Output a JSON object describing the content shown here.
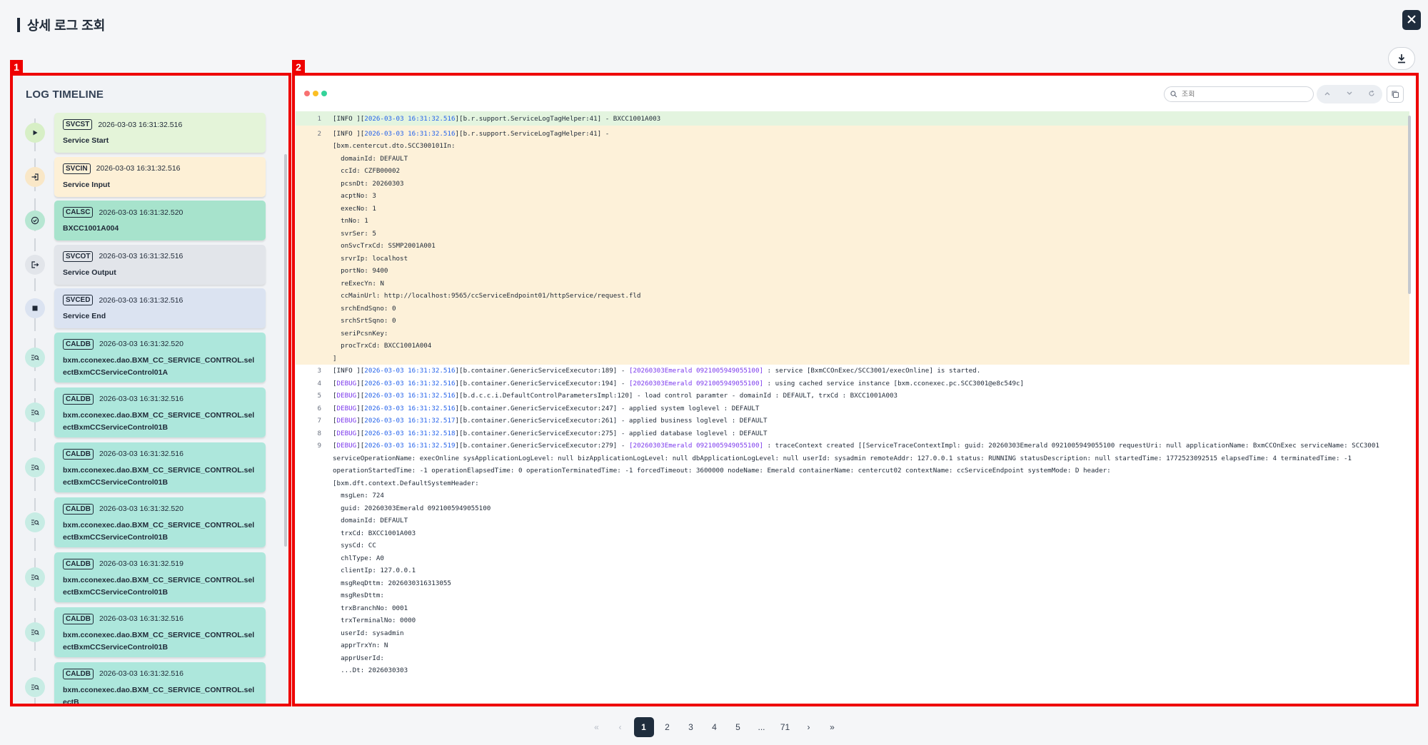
{
  "header": {
    "title": "상세 로그 조회"
  },
  "frames": {
    "left_tag": "1",
    "right_tag": "2"
  },
  "timeline": {
    "title": "LOG TIMELINE",
    "items": [
      {
        "code": "SVCST",
        "time": "2026-03-03 16:31:32.516",
        "name": "Service Start",
        "icon": "play-icon",
        "color": "#e4f4d9",
        "dot": "#d7efc6"
      },
      {
        "code": "SVCIN",
        "time": "2026-03-03 16:31:32.516",
        "name": "Service Input",
        "icon": "login-icon",
        "color": "#fdf0d6",
        "dot": "#f9e7c7"
      },
      {
        "code": "CALSC",
        "time": "2026-03-03 16:31:32.520",
        "name": "BXCC1001A004",
        "icon": "check-circle-icon",
        "color": "#a7e3cc",
        "dot": "#b6e6d2"
      },
      {
        "code": "SVCOT",
        "time": "2026-03-03 16:31:32.516",
        "name": "Service Output",
        "icon": "logout-icon",
        "color": "#e2e5ea",
        "dot": "#e2e5ea"
      },
      {
        "code": "SVCED",
        "time": "2026-03-03 16:31:32.516",
        "name": "Service End",
        "icon": "stop-icon",
        "color": "#dbe3f1",
        "dot": "#dbe3f1"
      },
      {
        "code": "CALDB",
        "time": "2026-03-03 16:31:32.520",
        "name": "bxm.cconexec.dao.BXM_CC_SERVICE_CONTROL.selectBxmCCServiceControl01A",
        "icon": "db-search-icon",
        "color": "#ade7dc",
        "dot": "#c7ece4"
      },
      {
        "code": "CALDB",
        "time": "2026-03-03 16:31:32.516",
        "name": "bxm.cconexec.dao.BXM_CC_SERVICE_CONTROL.selectBxmCCServiceControl01B",
        "icon": "db-search-icon",
        "color": "#ade7dc",
        "dot": "#c7ece4"
      },
      {
        "code": "CALDB",
        "time": "2026-03-03 16:31:32.516",
        "name": "bxm.cconexec.dao.BXM_CC_SERVICE_CONTROL.selectBxmCCServiceControl01B",
        "icon": "db-search-icon",
        "color": "#ade7dc",
        "dot": "#c7ece4"
      },
      {
        "code": "CALDB",
        "time": "2026-03-03 16:31:32.520",
        "name": "bxm.cconexec.dao.BXM_CC_SERVICE_CONTROL.selectBxmCCServiceControl01B",
        "icon": "db-search-icon",
        "color": "#ade7dc",
        "dot": "#c7ece4"
      },
      {
        "code": "CALDB",
        "time": "2026-03-03 16:31:32.519",
        "name": "bxm.cconexec.dao.BXM_CC_SERVICE_CONTROL.selectBxmCCServiceControl01B",
        "icon": "db-search-icon",
        "color": "#ade7dc",
        "dot": "#c7ece4"
      },
      {
        "code": "CALDB",
        "time": "2026-03-03 16:31:32.516",
        "name": "bxm.cconexec.dao.BXM_CC_SERVICE_CONTROL.selectBxmCCServiceControl01B",
        "icon": "db-search-icon",
        "color": "#ade7dc",
        "dot": "#c7ece4"
      },
      {
        "code": "CALDB",
        "time": "2026-03-03 16:31:32.516",
        "name": "bxm.cconexec.dao.BXM_CC_SERVICE_CONTROL.selectB",
        "icon": "db-search-icon",
        "color": "#ade7dc",
        "dot": "#c7ece4"
      }
    ]
  },
  "log_view": {
    "search_placeholder": "조회",
    "lines": [
      {
        "n": "1",
        "hl": "green",
        "level": "INFO ",
        "ts": "2026-03-03 16:31:32.516",
        "text": "[b.r.support.ServiceLogTagHelper:41] - BXCC1001A003"
      },
      {
        "n": "2",
        "hl": "yellow",
        "level": "INFO ",
        "ts": "2026-03-03 16:31:32.516",
        "text": "[b.r.support.ServiceLogTagHelper:41] -\n[bxm.centercut.dto.SCC300101In:\n  domainId: DEFAULT\n  ccId: CZFB00002\n  pcsnDt: 20260303\n  acptNo: 3\n  execNo: 1\n  tnNo: 1\n  svrSer: 5\n  onSvcTrxCd: SSMP2001A001\n  srvrIp: localhost\n  portNo: 9400\n  reExecYn: N\n  ccMainUrl: http://localhost:9565/ccServiceEndpoint01/httpService/request.fld\n  srchEndSqno: 0\n  srchSrtSqno: 0\n  seriPcsnKey:\n  procTrxCd: BXCC1001A004\n]\n"
      },
      {
        "n": "3",
        "hl": "",
        "level": "INFO ",
        "ts": "2026-03-03 16:31:32.516",
        "text": "[b.container.GenericServiceExecutor:189] - ",
        "guid": "[20260303Emerald 0921005949055100]",
        "tail": " : service [BxmCCOnExec/SCC3001/execOnline] is started."
      },
      {
        "n": "4",
        "hl": "",
        "level": "DEBUG",
        "ts": "2026-03-03 16:31:32.516",
        "text": "[b.container.GenericServiceExecutor:194] - ",
        "guid": "[20260303Emerald 0921005949055100]",
        "tail": " : using cached service instance [bxm.cconexec.pc.SCC3001@e8c549c]"
      },
      {
        "n": "5",
        "hl": "",
        "level": "DEBUG",
        "ts": "2026-03-03 16:31:32.516",
        "text": "[b.d.c.c.i.DefaultControlParametersImpl:120] - load control paramter - domainId : DEFAULT, trxCd : BXCC1001A003"
      },
      {
        "n": "6",
        "hl": "",
        "level": "DEBUG",
        "ts": "2026-03-03 16:31:32.516",
        "text": "[b.container.GenericServiceExecutor:247] - applied system loglevel : DEFAULT"
      },
      {
        "n": "7",
        "hl": "",
        "level": "DEBUG",
        "ts": "2026-03-03 16:31:32.517",
        "text": "[b.container.GenericServiceExecutor:261] - applied business loglevel : DEFAULT"
      },
      {
        "n": "8",
        "hl": "",
        "level": "DEBUG",
        "ts": "2026-03-03 16:31:32.518",
        "text": "[b.container.GenericServiceExecutor:275] - applied database loglevel : DEFAULT"
      },
      {
        "n": "9",
        "hl": "",
        "level": "DEBUG",
        "ts": "2026-03-03 16:31:32.519",
        "text": "[b.container.GenericServiceExecutor:279] - ",
        "guid": "[20260303Emerald 0921005949055100]",
        "tail": " : traceContext created [[ServiceTraceContextImpl: guid: 20260303Emerald 0921005949055100 requestUri: null applicationName: BxmCCOnExec serviceName: SCC3001 serviceOperationName: execOnline sysApplicationLogLevel: null bizApplicationLogLevel: null dbApplicationLogLevel: null userId: sysadmin remoteAddr: 127.0.0.1 status: RUNNING statusDescription: null startedTime: 1772523092515 elapsedTime: 4 terminatedTime: -1 operationStartedTime: -1 operationElapsedTime: 0 operationTerminatedTime: -1 forcedTimeout: 3600000 nodeName: Emerald containerName: centercut02 contextName: ccServiceEndpoint systemMode: D header:\n[bxm.dft.context.DefaultSystemHeader:\n  msgLen: 724\n  guid: 20260303Emerald 0921005949055100\n  domainId: DEFAULT\n  trxCd: BXCC1001A003\n  sysCd: CC\n  chlType: A0\n  clientIp: 127.0.0.1\n  msgReqDttm: 2026030316313055\n  msgResDttm:\n  trxBranchNo: 0001\n  trxTerminalNo: 0000\n  userId: sysadmin\n  apprTrxYn: N\n  apprUserId:\n  ...Dt: 2026030303"
      }
    ]
  },
  "pagination": {
    "first": "«",
    "prev": "‹",
    "pages": [
      "1",
      "2",
      "3",
      "4",
      "5",
      "...",
      "71"
    ],
    "active": "1",
    "next": "›",
    "last": "»"
  }
}
